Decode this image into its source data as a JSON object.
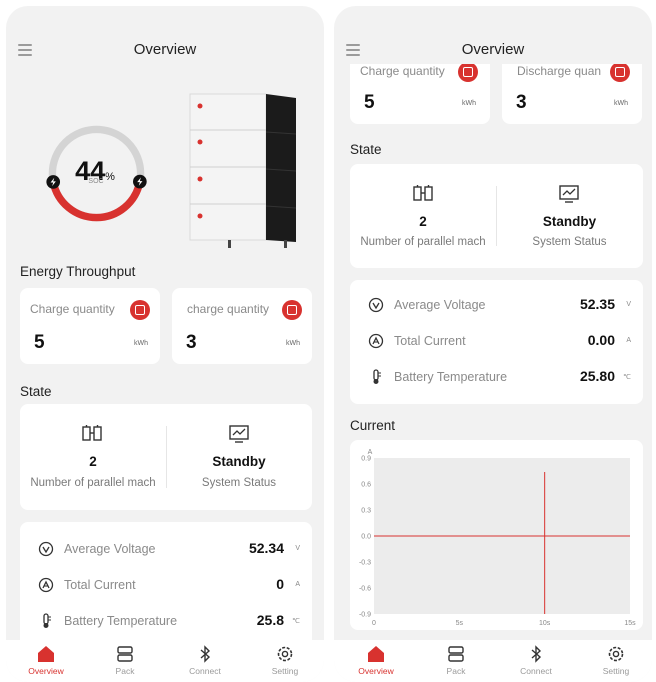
{
  "screen1": {
    "header": {
      "title": "Overview"
    },
    "gauge": {
      "value": "44",
      "unit": "%",
      "label": "SOC",
      "fraction": 0.44
    },
    "energy": {
      "title": "Energy Throughput",
      "charge": {
        "label": "Charge quantity",
        "value": "5",
        "unit": "kWh"
      },
      "discharge": {
        "label": "charge quantity",
        "value": "3",
        "unit": "kWh"
      }
    },
    "state": {
      "title": "State",
      "parallel": {
        "value": "2",
        "label": "Number of parallel mach"
      },
      "status": {
        "value": "Standby",
        "label": "System Status"
      }
    },
    "metrics": [
      {
        "label": "Average Voltage",
        "value": "52.34",
        "unit": "V"
      },
      {
        "label": "Total Current",
        "value": "0",
        "unit": "A"
      },
      {
        "label": "Battery Temperature",
        "value": "25.8",
        "unit": "℃"
      }
    ]
  },
  "screen2": {
    "header": {
      "title": "Overview"
    },
    "energy": {
      "charge": {
        "label": "Charge quantity",
        "value": "5",
        "unit": "kWh"
      },
      "discharge": {
        "label": "Discharge quan",
        "value": "3",
        "unit": "kWh"
      }
    },
    "state": {
      "title": "State",
      "parallel": {
        "value": "2",
        "label": "Number of parallel mach"
      },
      "status": {
        "value": "Standby",
        "label": "System Status"
      }
    },
    "metrics": [
      {
        "label": "Average Voltage",
        "value": "52.35",
        "unit": "V"
      },
      {
        "label": "Total Current",
        "value": "0.00",
        "unit": "A"
      },
      {
        "label": "Battery Temperature",
        "value": "25.80",
        "unit": "℃"
      }
    ],
    "current": {
      "title": "Current"
    }
  },
  "nav": [
    {
      "label": "Overview",
      "icon": "home-icon",
      "active": true
    },
    {
      "label": "Pack",
      "icon": "pack-icon"
    },
    {
      "label": "Connect",
      "icon": "bluetooth-icon"
    },
    {
      "label": "Setting",
      "icon": "gear-icon"
    }
  ],
  "colors": {
    "accent": "#d8322f",
    "background": "#f2f2f2",
    "card": "#ffffff"
  },
  "chart_data": {
    "type": "line",
    "title": "Current",
    "ylabel": "A",
    "y_ticks": [
      "0.9",
      "0.6",
      "0.3",
      "0.0",
      "-0.3",
      "-0.6",
      "-0.9"
    ],
    "x_ticks": [
      "0",
      "5s",
      "10s",
      "15s"
    ],
    "ylim": [
      -0.9,
      0.9
    ],
    "xlim": [
      0,
      15
    ],
    "series": [
      {
        "x": [
          0,
          15
        ],
        "values": [
          0,
          0
        ]
      }
    ],
    "annotations": {
      "crosshair_x": 10,
      "crosshair_y": 0.0
    },
    "color": "#d8322f"
  }
}
